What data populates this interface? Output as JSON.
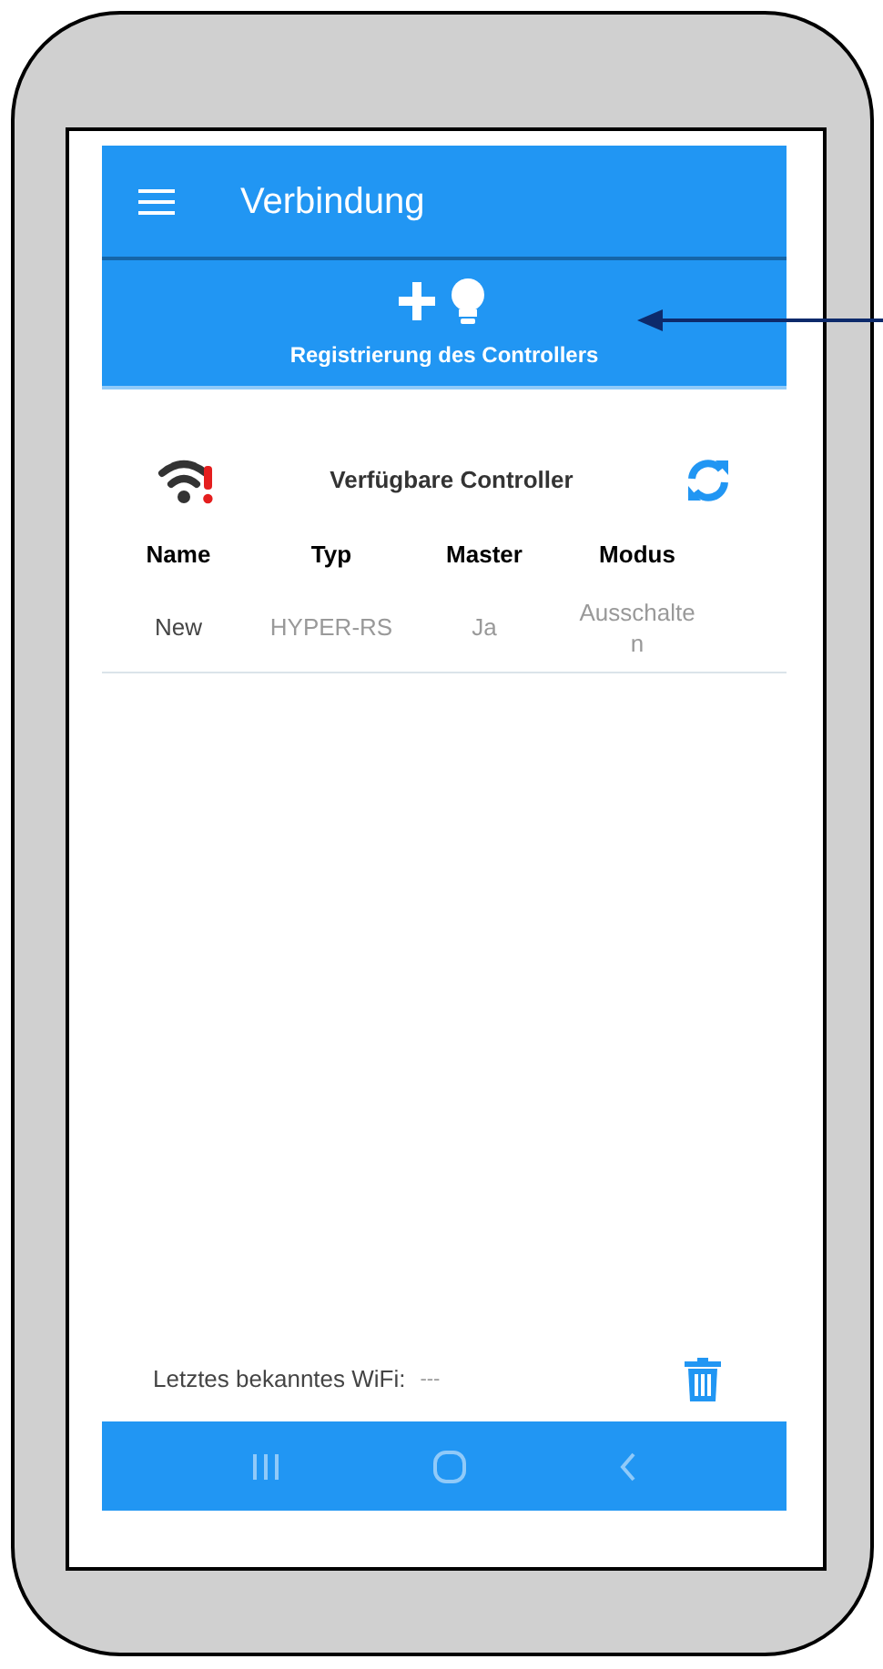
{
  "app_bar": {
    "title": "Verbindung"
  },
  "register_button": {
    "label": "Registrierung des Controllers"
  },
  "controllers": {
    "title": "Verfügbare Controller",
    "wifi_warning": true
  },
  "table": {
    "columns": [
      "Name",
      "Typ",
      "Master",
      "Modus"
    ],
    "rows": [
      [
        "New",
        "HYPER-RS",
        "Ja",
        "Ausschalten"
      ]
    ]
  },
  "footer": {
    "label": "Letztes bekanntes WiFi:",
    "value": "---"
  }
}
